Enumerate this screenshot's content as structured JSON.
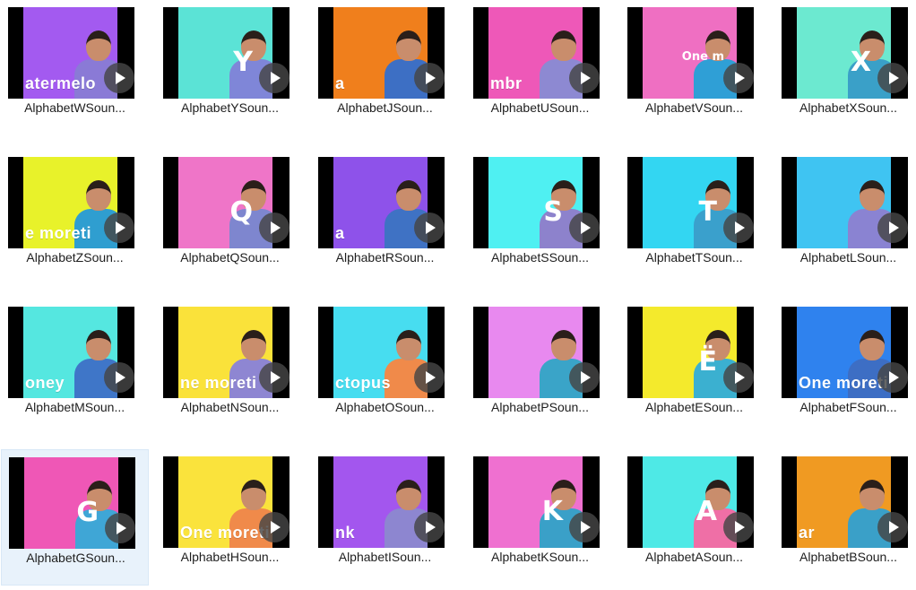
{
  "files": [
    {
      "name": "AlphabetWSoun...",
      "bg": "#a35af0",
      "person": "#8a7ad6",
      "word": "atermelo",
      "letter": ""
    },
    {
      "name": "AlphabetYSoun...",
      "bg": "#5be3d6",
      "person": "#7f86d8",
      "word": "",
      "letter": "Y"
    },
    {
      "name": "AlphabetJSoun...",
      "bg": "#f07f1c",
      "person": "#3d6fc4",
      "word": "a",
      "letter": ""
    },
    {
      "name": "AlphabetUSoun...",
      "bg": "#ee58b8",
      "person": "#8d89d2",
      "word": "mbr",
      "letter": ""
    },
    {
      "name": "AlphabetVSoun...",
      "bg": "#ef6fc2",
      "person": "#2f9fd6",
      "word": "",
      "letter": "One m"
    },
    {
      "name": "AlphabetXSoun...",
      "bg": "#6ce9d0",
      "person": "#3aa0c8",
      "word": "",
      "letter": "X"
    },
    {
      "name": "AlphabetZSoun...",
      "bg": "#e8f22a",
      "person": "#2f9ed0",
      "word": "e moreti",
      "letter": ""
    },
    {
      "name": "AlphabetQSoun...",
      "bg": "#ef75c8",
      "person": "#7e86cf",
      "word": "",
      "letter": "Q"
    },
    {
      "name": "AlphabetRSoun...",
      "bg": "#8e52ea",
      "person": "#3f72c4",
      "word": "a",
      "letter": ""
    },
    {
      "name": "AlphabetSSoun...",
      "bg": "#4ff0f2",
      "person": "#8d82cc",
      "word": "",
      "letter": "S"
    },
    {
      "name": "AlphabetTSoun...",
      "bg": "#33d6f2",
      "person": "#3aa0cc",
      "word": "",
      "letter": "T"
    },
    {
      "name": "AlphabetLSoun...",
      "bg": "#3fc4f2",
      "person": "#8a83d2",
      "word": "",
      "letter": ""
    },
    {
      "name": "AlphabetMSoun...",
      "bg": "#55e7e0",
      "person": "#3f76c8",
      "word": "oney",
      "letter": ""
    },
    {
      "name": "AlphabetNSoun...",
      "bg": "#fae23a",
      "person": "#8e86d2",
      "word": "ne moreti",
      "letter": ""
    },
    {
      "name": "AlphabetOSoun...",
      "bg": "#47ddf0",
      "person": "#f08a4a",
      "word": "ctopus",
      "letter": ""
    },
    {
      "name": "AlphabetPSoun...",
      "bg": "#e889ef",
      "person": "#3aa4c8",
      "word": "",
      "letter": ""
    },
    {
      "name": "AlphabetESoun...",
      "bg": "#f4ea2c",
      "person": "#3bb0d0",
      "word": "",
      "letter": "Ë"
    },
    {
      "name": "AlphabetFSoun...",
      "bg": "#2f82ee",
      "person": "#3d6ec4",
      "word": "One moreti",
      "letter": ""
    },
    {
      "name": "AlphabetGSoun...",
      "bg": "#ef57b6",
      "person": "#3fa6d6",
      "word": "",
      "letter": "G"
    },
    {
      "name": "AlphabetHSoun...",
      "bg": "#fae33c",
      "person": "#f08a4a",
      "word": "One moreti",
      "letter": ""
    },
    {
      "name": "AlphabetISoun...",
      "bg": "#a356ee",
      "person": "#8d86d0",
      "word": "nk",
      "letter": ""
    },
    {
      "name": "AlphabetKSoun...",
      "bg": "#ef70d0",
      "person": "#3aa0c8",
      "word": "",
      "letter": "K"
    },
    {
      "name": "AlphabetASoun...",
      "bg": "#4ee9e6",
      "person": "#ef6fa6",
      "word": "",
      "letter": "A"
    },
    {
      "name": "AlphabetBSoun...",
      "bg": "#f09a22",
      "person": "#3aa0c8",
      "word": "ar",
      "letter": ""
    }
  ],
  "selected_index": 18
}
